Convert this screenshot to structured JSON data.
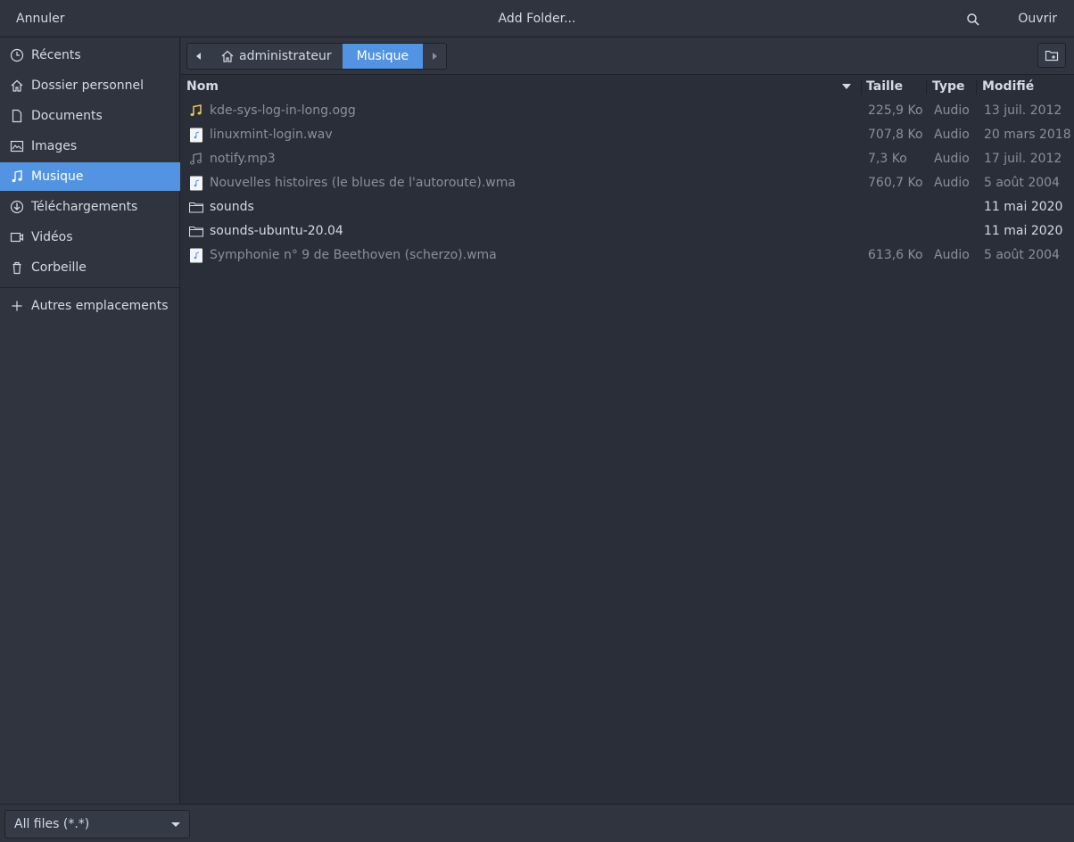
{
  "header": {
    "cancel_label": "Annuler",
    "title": "Add Folder...",
    "open_label": "Ouvrir"
  },
  "sidebar": {
    "items": [
      {
        "label": "Récents",
        "icon": "clock-icon"
      },
      {
        "label": "Dossier personnel",
        "icon": "home-icon"
      },
      {
        "label": "Documents",
        "icon": "document-icon"
      },
      {
        "label": "Images",
        "icon": "image-icon"
      },
      {
        "label": "Musique",
        "icon": "music-icon",
        "active": true
      },
      {
        "label": "Téléchargements",
        "icon": "download-icon"
      },
      {
        "label": "Vidéos",
        "icon": "video-icon"
      },
      {
        "label": "Corbeille",
        "icon": "trash-icon"
      }
    ],
    "other_locations": "Autres emplacements"
  },
  "pathbar": {
    "crumbs": [
      "administrateur",
      "Musique"
    ]
  },
  "columns": {
    "name": "Nom",
    "size": "Taille",
    "type": "Type",
    "modified": "Modifié"
  },
  "files": [
    {
      "name": "kde-sys-log-in-long.ogg",
      "size": "225,9 Ko",
      "type": "Audio",
      "modified": "13 juil. 2012",
      "icon": "music-note-icon"
    },
    {
      "name": "linuxmint-login.wav",
      "size": "707,8 Ko",
      "type": "Audio",
      "modified": "20 mars 2018",
      "icon": "audio-file-icon"
    },
    {
      "name": "notify.mp3",
      "size": "7,3 Ko",
      "type": "Audio",
      "modified": "17 juil. 2012",
      "icon": "music-note-icon"
    },
    {
      "name": "Nouvelles histoires (le blues de l'autoroute).wma",
      "size": "760,7 Ko",
      "type": "Audio",
      "modified": "5 août 2004",
      "icon": "audio-file-icon"
    },
    {
      "name": "sounds",
      "size": "",
      "type": "",
      "modified": "11 mai 2020",
      "icon": "folder-icon"
    },
    {
      "name": "sounds-ubuntu-20.04",
      "size": "",
      "type": "",
      "modified": "11 mai 2020",
      "icon": "folder-icon"
    },
    {
      "name": "Symphonie n° 9 de Beethoven (scherzo).wma",
      "size": "613,6 Ko",
      "type": "Audio",
      "modified": "5 août 2004",
      "icon": "audio-file-icon"
    }
  ],
  "footer": {
    "filter_value": "All files (*.*)"
  },
  "colors": {
    "accent": "#5294e2",
    "bg": "#2a2e38",
    "panel": "#2f343f"
  }
}
